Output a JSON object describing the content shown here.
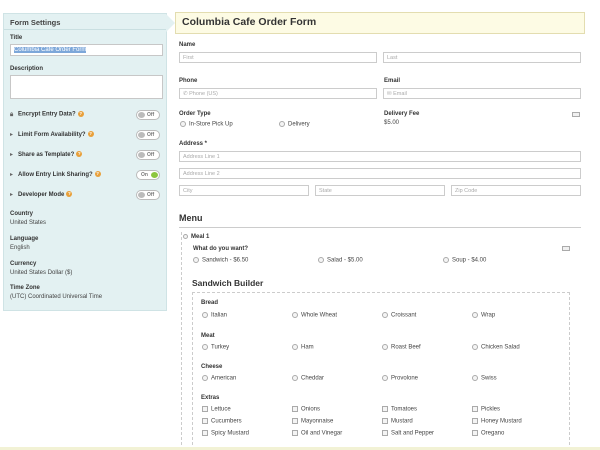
{
  "sidebar": {
    "header": "Form Settings",
    "title_label": "Title",
    "title_value": "Columbia Cafe Order Form",
    "description_label": "Description",
    "description_value": "",
    "settings": [
      {
        "label": "Encrypt Entry Data?",
        "icon": "lock-icon",
        "state": "Off"
      },
      {
        "label": "Limit Form Availability?",
        "icon": "caret-right-icon",
        "state": "Off"
      },
      {
        "label": "Share as Template?",
        "icon": "caret-right-icon",
        "state": "Off"
      },
      {
        "label": "Allow Entry Link Sharing?",
        "icon": "caret-right-icon",
        "state": "On"
      },
      {
        "label": "Developer Mode",
        "icon": "caret-right-icon",
        "state": "Off"
      }
    ],
    "country_label": "Country",
    "country_value": "United States",
    "language_label": "Language",
    "language_value": "English",
    "currency_label": "Currency",
    "currency_value": "United States Dollar ($)",
    "timezone_label": "Time Zone",
    "timezone_value": "(UTC) Coordinated Universal Time"
  },
  "form": {
    "title": "Columbia Cafe Order Form",
    "name_label": "Name",
    "first_placeholder": "First",
    "last_placeholder": "Last",
    "phone_label": "Phone",
    "phone_placeholder": "Phone (US)",
    "email_label": "Email",
    "email_placeholder": "Email",
    "order_type_label": "Order Type",
    "order_type_options": [
      "In-Store Pick Up",
      "Delivery"
    ],
    "delivery_fee_label": "Delivery Fee",
    "delivery_fee_value": "$5.00",
    "address_label": "Address *",
    "address1_placeholder": "Address Line 1",
    "address2_placeholder": "Address Line 2",
    "city_placeholder": "City",
    "state_placeholder": "State",
    "zip_placeholder": "Zip Code",
    "menu_heading": "Menu",
    "meal_label": "Meal 1",
    "want_label": "What do you want?",
    "want_options": [
      "Sandwich - $6.50",
      "Salad - $5.00",
      "Soup - $4.00"
    ],
    "sandwich_heading": "Sandwich Builder",
    "bread_label": "Bread",
    "bread_options": [
      "Italian",
      "Whole Wheat",
      "Croissant",
      "Wrap"
    ],
    "meat_label": "Meat",
    "meat_options": [
      "Turkey",
      "Ham",
      "Roast Beef",
      "Chicken Salad"
    ],
    "cheese_label": "Cheese",
    "cheese_options": [
      "American",
      "Cheddar",
      "Provolone",
      "Swiss"
    ],
    "extras_label": "Extras",
    "extras_options": [
      "Lettuce",
      "Onions",
      "Tomatoes",
      "Pickles",
      "Cucumbers",
      "Mayonnaise",
      "Mustard",
      "Honey Mustard",
      "Spicy Mustard",
      "Oil and Vinegar",
      "Salt and Pepper",
      "Oregano"
    ]
  }
}
